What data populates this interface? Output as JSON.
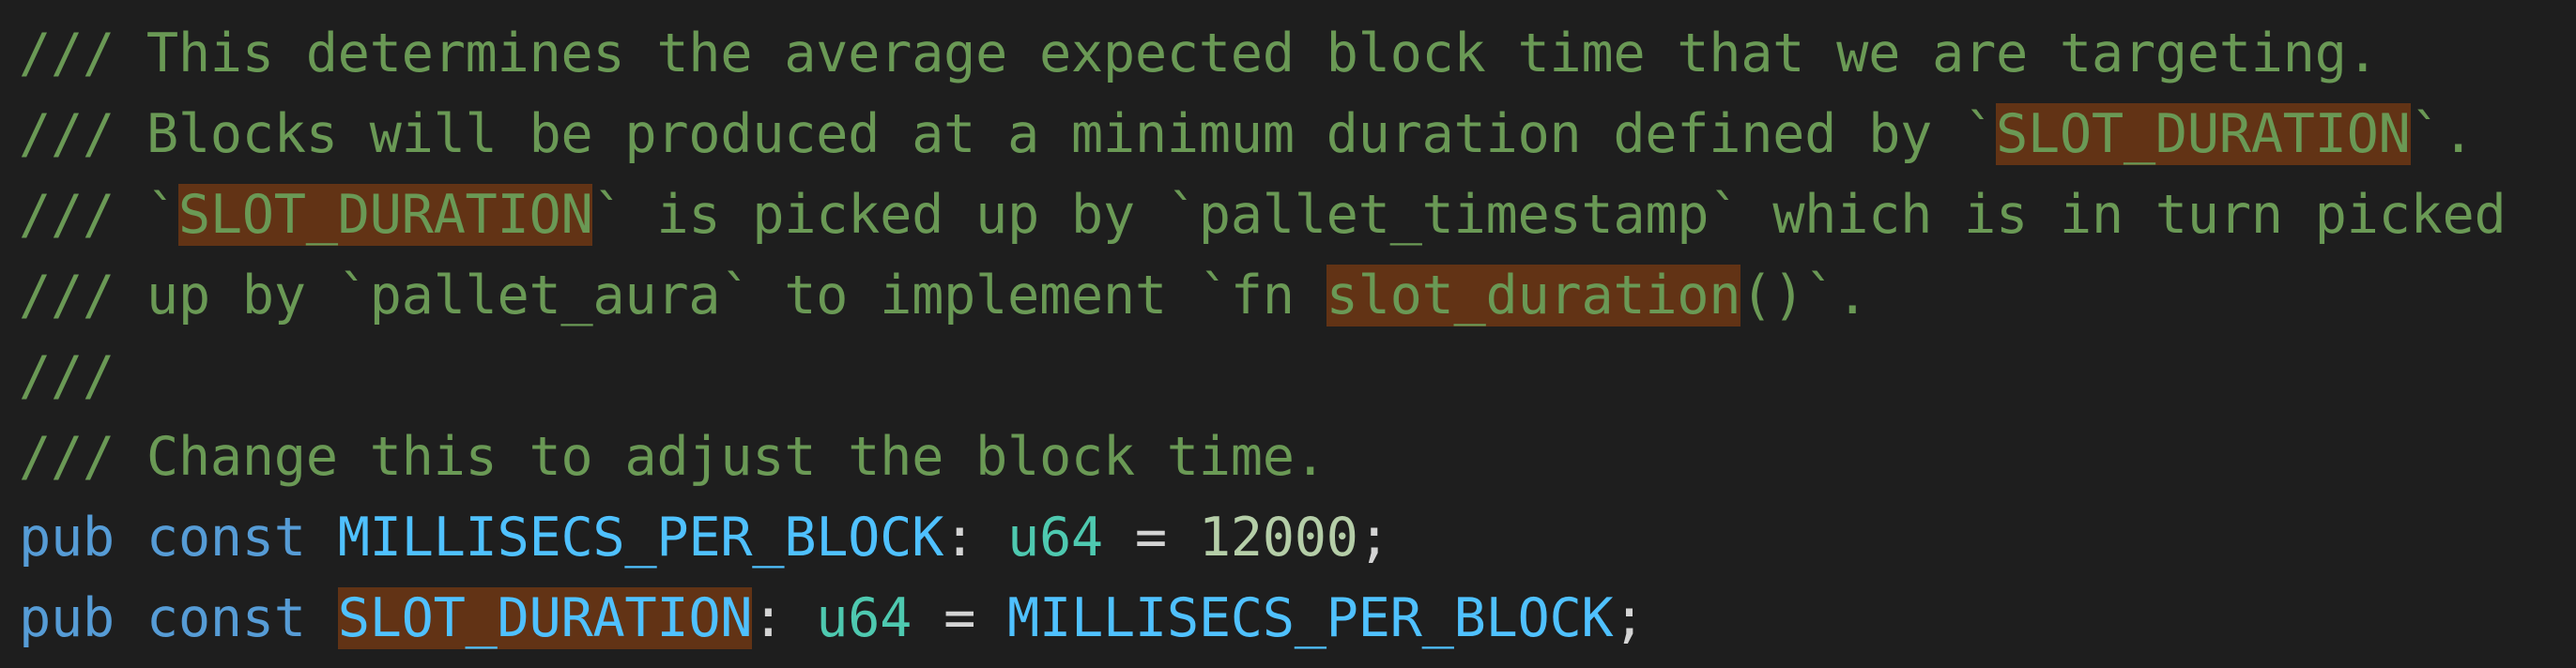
{
  "editor": {
    "language": "rust",
    "colors": {
      "background": "#1e1e1e",
      "comment": "#6a9955",
      "keyword": "#569cd6",
      "constant": "#4fc1ff",
      "type": "#4ec9b0",
      "number": "#b5cea8",
      "punctuation": "#d4d4d4",
      "highlight": "#623315"
    },
    "lines": [
      {
        "tokens": [
          {
            "text": "/// This determines the average expected block time that we are targeting.",
            "kind": "comment"
          }
        ]
      },
      {
        "tokens": [
          {
            "text": "/// Blocks will be produced at a minimum duration defined by `",
            "kind": "comment"
          },
          {
            "text": "SLOT_DURATION",
            "kind": "comment",
            "highlight": true
          },
          {
            "text": "`.",
            "kind": "comment"
          }
        ]
      },
      {
        "tokens": [
          {
            "text": "/// `",
            "kind": "comment"
          },
          {
            "text": "SLOT_DURATION",
            "kind": "comment",
            "highlight": true
          },
          {
            "text": "` is picked up by `pallet_timestamp` which is in turn picked",
            "kind": "comment"
          }
        ]
      },
      {
        "tokens": [
          {
            "text": "/// up by `pallet_aura` to implement `fn ",
            "kind": "comment"
          },
          {
            "text": "slot_duration",
            "kind": "comment",
            "highlight": true
          },
          {
            "text": "()`.",
            "kind": "comment"
          }
        ]
      },
      {
        "tokens": [
          {
            "text": "///",
            "kind": "comment"
          }
        ]
      },
      {
        "tokens": [
          {
            "text": "/// Change this to adjust the block time.",
            "kind": "comment"
          }
        ]
      },
      {
        "tokens": [
          {
            "text": "pub",
            "kind": "kw"
          },
          {
            "text": " ",
            "kind": "punc"
          },
          {
            "text": "const",
            "kind": "kw"
          },
          {
            "text": " ",
            "kind": "punc"
          },
          {
            "text": "MILLISECS_PER_BLOCK",
            "kind": "const"
          },
          {
            "text": ": ",
            "kind": "punc"
          },
          {
            "text": "u64",
            "kind": "type"
          },
          {
            "text": " = ",
            "kind": "punc"
          },
          {
            "text": "12000",
            "kind": "num"
          },
          {
            "text": ";",
            "kind": "punc"
          }
        ]
      },
      {
        "tokens": [
          {
            "text": "pub",
            "kind": "kw"
          },
          {
            "text": " ",
            "kind": "punc"
          },
          {
            "text": "const",
            "kind": "kw"
          },
          {
            "text": " ",
            "kind": "punc"
          },
          {
            "text": "SLOT_DURATION",
            "kind": "const",
            "highlight": true
          },
          {
            "text": ": ",
            "kind": "punc"
          },
          {
            "text": "u64",
            "kind": "type"
          },
          {
            "text": " = ",
            "kind": "punc"
          },
          {
            "text": "MILLISECS_PER_BLOCK",
            "kind": "const"
          },
          {
            "text": ";",
            "kind": "punc"
          }
        ]
      }
    ]
  }
}
